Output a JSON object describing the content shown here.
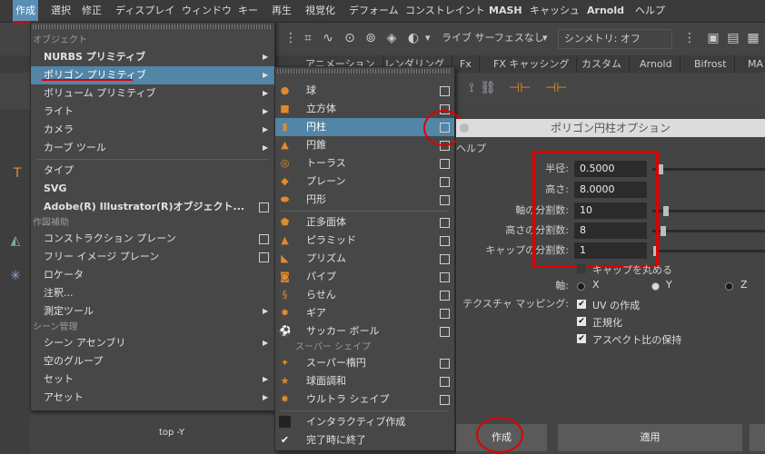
{
  "menubar": {
    "items": [
      "作成",
      "選択",
      "修正",
      "ディスプレイ",
      "ウィンドウ",
      "キー",
      "再生",
      "視覚化",
      "デフォーム",
      "コンストレイント",
      "MASH",
      "キャッシュ",
      "Arnold",
      "ヘルプ"
    ]
  },
  "toolbar": {
    "live_surface": "ライブ サーフェスなし",
    "symmetry": "シンメトリ: オフ"
  },
  "shelf": {
    "tabs": [
      "アニメーション",
      "レンダリング",
      "Fx",
      "FX キャッシング",
      "カスタム",
      "Arnold",
      "Bifrost",
      "MA"
    ]
  },
  "toolbox": {
    "viewport_label": "top -Y"
  },
  "create_menu": {
    "hdr_objects": "オブジェクト",
    "nurbs": "NURBS プリミティブ",
    "polygon": "ポリゴン プリミティブ",
    "volume": "ボリューム プリミティブ",
    "light": "ライト",
    "camera": "カメラ",
    "curve": "カーブ ツール",
    "type": "タイプ",
    "svg": "SVG",
    "illustrator": "Adobe(R) Illustrator(R)オブジェクト...",
    "hdr_construction": "作図補助",
    "cplane": "コンストラクション プレーン",
    "free_image": "フリー イメージ プレーン",
    "locator": "ロケータ",
    "annotation": "注釈...",
    "measure": "測定ツール",
    "hdr_scene": "シーン管理",
    "scene_assembly": "シーン アセンブリ",
    "empty_group": "空のグループ",
    "set": "セット",
    "asset": "アセット"
  },
  "poly_menu": {
    "sphere": "球",
    "cube": "立方体",
    "cylinder": "円柱",
    "cone": "円錐",
    "torus": "トーラス",
    "plane": "プレーン",
    "disc": "円形",
    "platonic": "正多面体",
    "pyramid": "ピラミッド",
    "prism": "プリズム",
    "pipe": "パイプ",
    "helix": "らせん",
    "gear": "ギア",
    "soccer": "サッカー ボール",
    "hdr_super": "スーパー シェイプ",
    "super_ellipse": "スーパー楕円",
    "sph_harmonics": "球面調和",
    "ultra_shape": "ウルトラ シェイプ",
    "interactive": "インタラクティブ作成",
    "exit_on_complete": "完了時に終了"
  },
  "dialog": {
    "title": "ポリゴン円柱オプション",
    "help": "ヘルプ",
    "radius_label": "半径:",
    "radius": "0.5000",
    "radius_slider": 0.05,
    "height_label": "高さ:",
    "height": "8.0000",
    "axis_div_label": "軸の分割数:",
    "axis_div": "10",
    "axis_div_slider": 0.1,
    "height_div_label": "高さの分割数:",
    "height_div": "8",
    "height_div_slider": 0.08,
    "cap_div_label": "キャップの分割数:",
    "cap_div": "1",
    "cap_div_slider": 0.01,
    "round_cap": "キャップを丸める",
    "axis_label": "軸:",
    "axis_x": "X",
    "axis_y": "Y",
    "axis_z": "Z",
    "axis_selected": "Y",
    "tex_label": "テクスチャ マッピング:",
    "uv_create": "UV の作成",
    "normalize": "正規化",
    "keep_aspect": "アスペクト比の保持",
    "create_btn": "作成",
    "apply_btn": "適用"
  },
  "colors": {
    "highlight": "#5285a6",
    "annotation_red": "#dd0000",
    "icon_orange": "#e08a2e"
  }
}
